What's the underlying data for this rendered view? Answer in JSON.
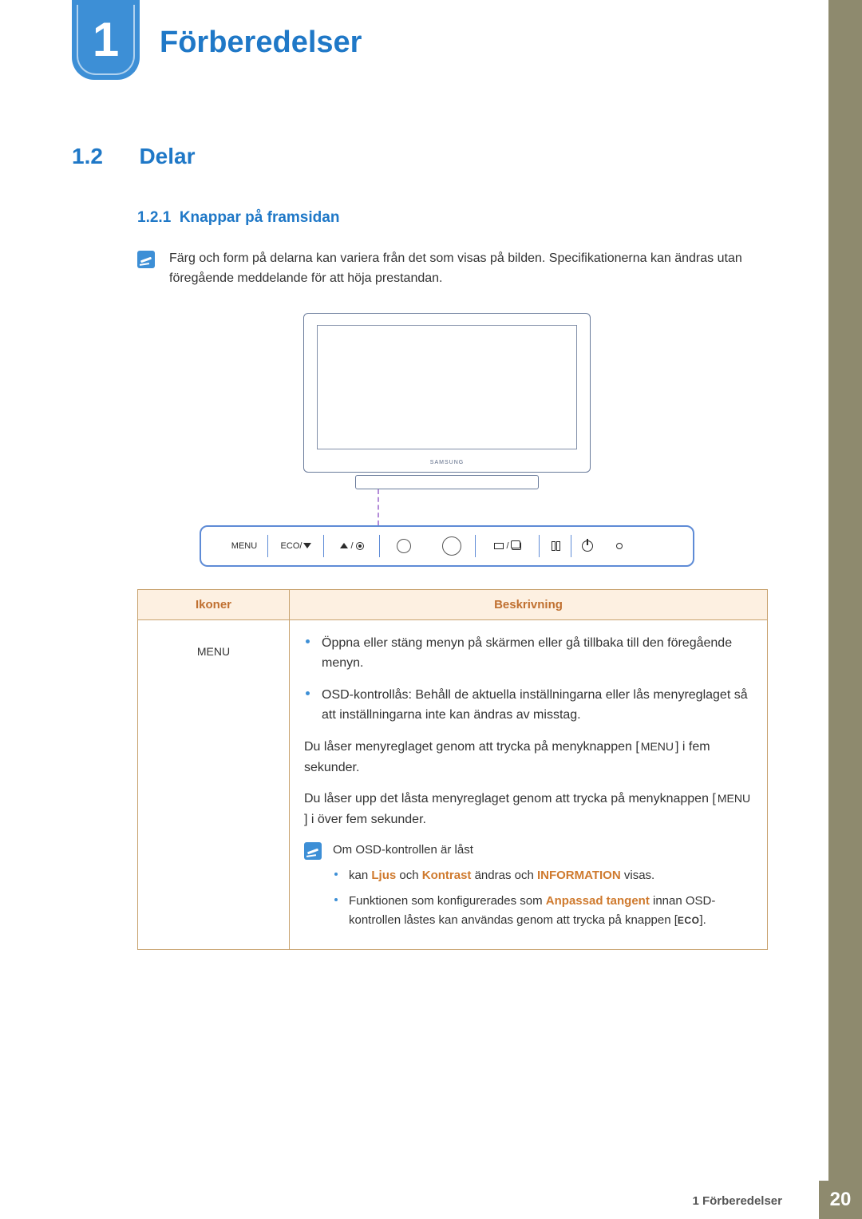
{
  "chapter": {
    "number": "1",
    "title": "Förberedelser"
  },
  "section": {
    "number": "1.2",
    "title": "Delar"
  },
  "subsection": {
    "number": "1.2.1",
    "title": "Knappar på framsidan"
  },
  "note": "Färg och form på delarna kan variera från det som visas på bilden. Specifikationerna kan ändras utan föregående meddelande för att höja prestandan.",
  "diagram": {
    "brand_label": "SAMSUNG",
    "buttons": {
      "menu": "MENU",
      "eco_down": "ECO/",
      "up_enter": "/",
      "auto_source": "/",
      "eco_key": "ECO"
    }
  },
  "table": {
    "headers": {
      "col1": "Ikoner",
      "col2": "Beskrivning"
    },
    "row1": {
      "icon_label": "MENU",
      "bullets": [
        "Öppna eller stäng menyn på skärmen eller gå tillbaka till den föregående menyn.",
        "OSD-kontrollås: Behåll de aktuella inställningarna eller lås menyreglaget så att inställningarna inte kan ändras av misstag."
      ],
      "para1_a": "Du låser menyreglaget genom att trycka på menyknappen [",
      "para1_key": "MENU",
      "para1_b": "] i fem sekunder.",
      "para2_a": "Du låser upp det låsta menyreglaget genom att trycka på menyknappen [",
      "para2_key": "MENU",
      "para2_b": "] i över fem sekunder.",
      "subnote_title": "Om OSD-kontrollen är låst",
      "sublist": [
        {
          "pre": "kan ",
          "h1": "Ljus",
          "mid1": " och ",
          "h2": "Kontrast",
          "mid2": " ändras och ",
          "h3": "INFORMATION",
          "post": " visas."
        },
        {
          "pre": "Funktionen som konfigurerades som ",
          "h1": "Anpassad tangent",
          "post": " innan OSD-kontrollen låstes kan användas genom att trycka på knappen [",
          "eco_key": "ECO",
          "end": "]."
        }
      ]
    }
  },
  "footer": {
    "text": "1 Förberedelser",
    "page": "20"
  }
}
